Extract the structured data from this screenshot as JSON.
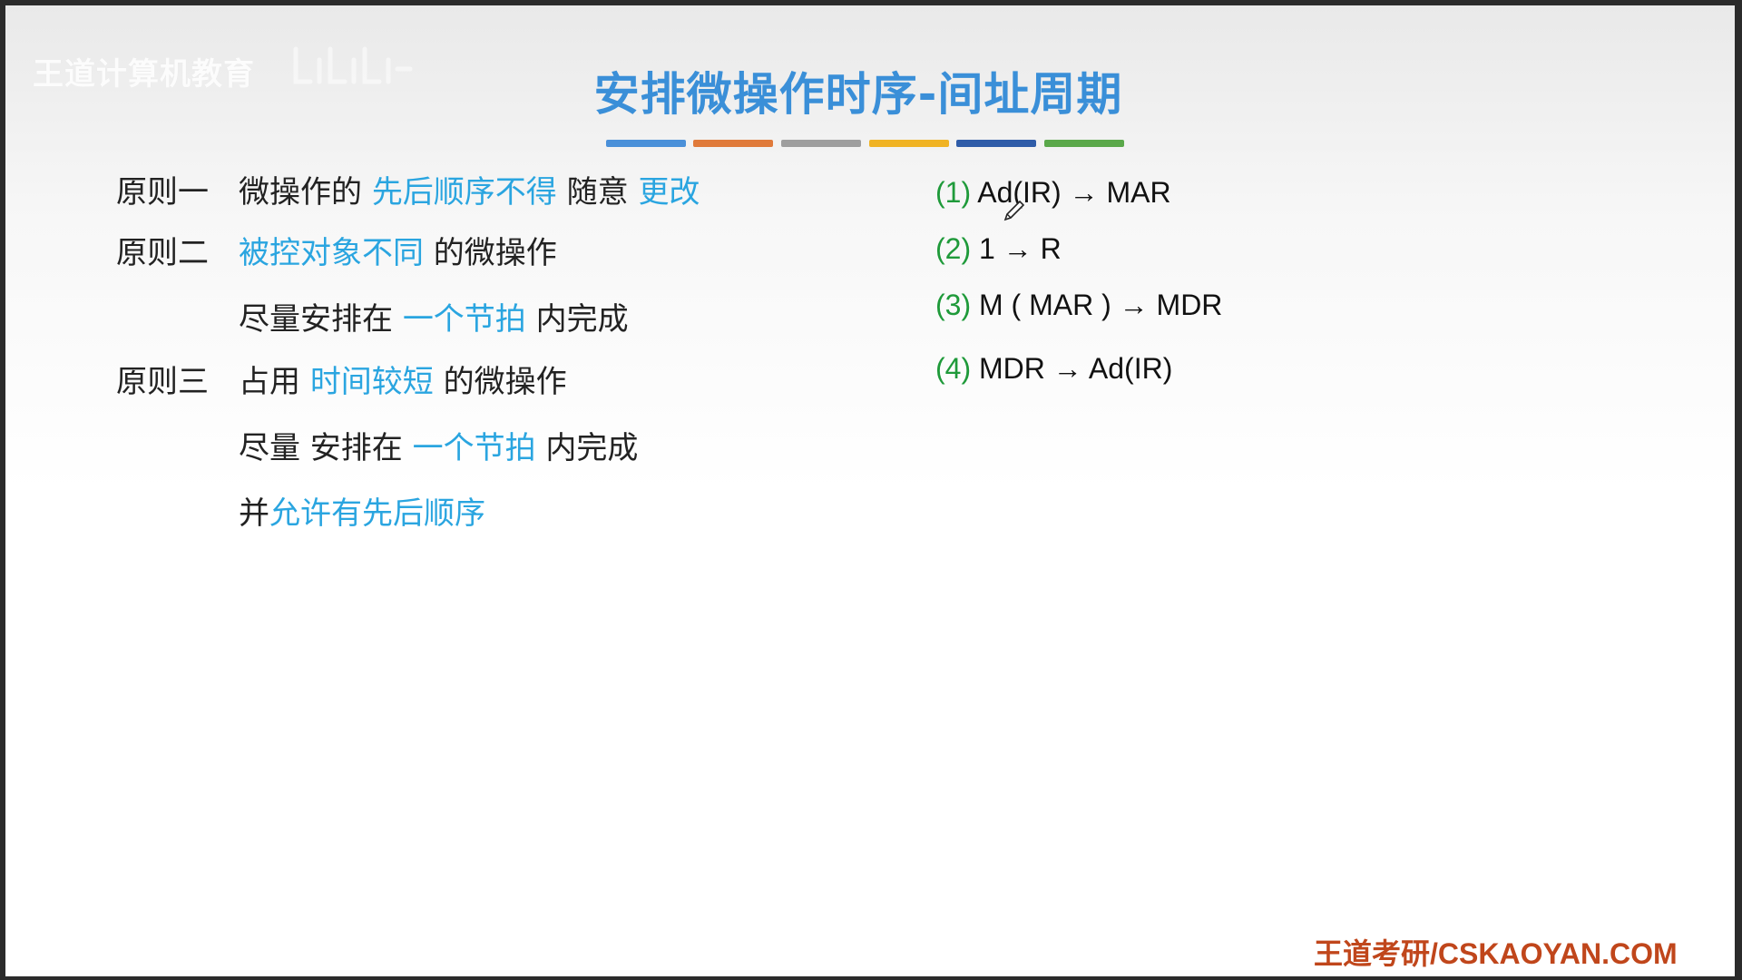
{
  "watermark": {
    "brand": "王道计算机教育"
  },
  "slide": {
    "title": "安排微操作时序-间址周期",
    "divider_colors": [
      "#4a90d9",
      "#e07a3a",
      "#9e9e9e",
      "#f0b323",
      "#2f5ca8",
      "#5aa84a"
    ]
  },
  "principles": [
    {
      "label": "原则一",
      "segments": [
        {
          "text": "微操作的 ",
          "highlight": false
        },
        {
          "text": "先后顺序不得",
          "highlight": true
        },
        {
          "text": " 随意 ",
          "highlight": false
        },
        {
          "text": "更改",
          "highlight": true
        }
      ]
    },
    {
      "label": "原则二",
      "segments": [
        {
          "text": "被控对象不同",
          "highlight": true
        },
        {
          "text": " 的微操作",
          "highlight": false
        }
      ]
    },
    {
      "label": "",
      "segments": [
        {
          "text": "尽量安排在 ",
          "highlight": false
        },
        {
          "text": "一个节拍",
          "highlight": true
        },
        {
          "text": " 内完成",
          "highlight": false
        }
      ]
    },
    {
      "label": "原则三",
      "segments": [
        {
          "text": "占用 ",
          "highlight": false
        },
        {
          "text": "时间较短",
          "highlight": true
        },
        {
          "text": " 的微操作",
          "highlight": false
        }
      ]
    },
    {
      "label": "",
      "segments": [
        {
          "text": "尽量 安排在 ",
          "highlight": false
        },
        {
          "text": "一个节拍",
          "highlight": true
        },
        {
          "text": " 内完成",
          "highlight": false
        }
      ]
    },
    {
      "label": "",
      "segments": [
        {
          "text": "并",
          "highlight": false
        },
        {
          "text": "允许有先后顺序",
          "highlight": true
        }
      ]
    }
  ],
  "micro_ops": [
    {
      "num": "(1)",
      "op": "Ad(IR) → MAR"
    },
    {
      "num": "(2)",
      "op": "1 → R"
    },
    {
      "num": "(3)",
      "op": "M ( MAR ) → MDR"
    },
    {
      "num": "(4)",
      "op": "MDR → Ad(IR)"
    }
  ],
  "footer": {
    "text": "王道考研/CSKAOYAN.COM"
  },
  "colors": {
    "title": "#3a8fd8",
    "highlight": "#2aa5e0",
    "step_number": "#1f9a3a",
    "footer": "#c0461b"
  }
}
